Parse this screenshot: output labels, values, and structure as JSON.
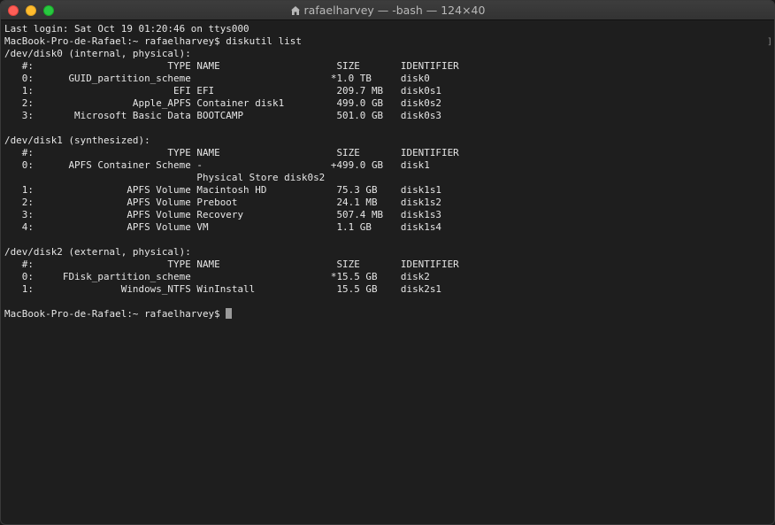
{
  "window": {
    "title": "rafaelharvey — -bash — 124×40",
    "title_icon": "home-icon"
  },
  "terminal": {
    "lines": [
      "Last login: Sat Oct 19 01:20:46 on ttys000",
      "MacBook-Pro-de-Rafael:~ rafaelharvey$ diskutil list",
      "/dev/disk0 (internal, physical):",
      "   #:                       TYPE NAME                    SIZE       IDENTIFIER",
      "   0:      GUID_partition_scheme                        *1.0 TB     disk0",
      "   1:                        EFI EFI                     209.7 MB   disk0s1",
      "   2:                 Apple_APFS Container disk1         499.0 GB   disk0s2",
      "   3:       Microsoft Basic Data BOOTCAMP                501.0 GB   disk0s3",
      "",
      "/dev/disk1 (synthesized):",
      "   #:                       TYPE NAME                    SIZE       IDENTIFIER",
      "   0:      APFS Container Scheme -                      +499.0 GB   disk1",
      "                                 Physical Store disk0s2",
      "   1:                APFS Volume Macintosh HD            75.3 GB    disk1s1",
      "   2:                APFS Volume Preboot                 24.1 MB    disk1s2",
      "   3:                APFS Volume Recovery                507.4 MB   disk1s3",
      "   4:                APFS Volume VM                      1.1 GB     disk1s4",
      "",
      "/dev/disk2 (external, physical):",
      "   #:                       TYPE NAME                    SIZE       IDENTIFIER",
      "   0:     FDisk_partition_scheme                        *15.5 GB    disk2",
      "   1:               Windows_NTFS WinInstall              15.5 GB    disk2s1",
      ""
    ],
    "prompt": "MacBook-Pro-de-Rafael:~ rafaelharvey$ ",
    "scroll_marker": "]"
  },
  "colors": {
    "background": "#1e1e1e",
    "text": "#e6e6e6",
    "cursor": "#9a9a9a"
  }
}
